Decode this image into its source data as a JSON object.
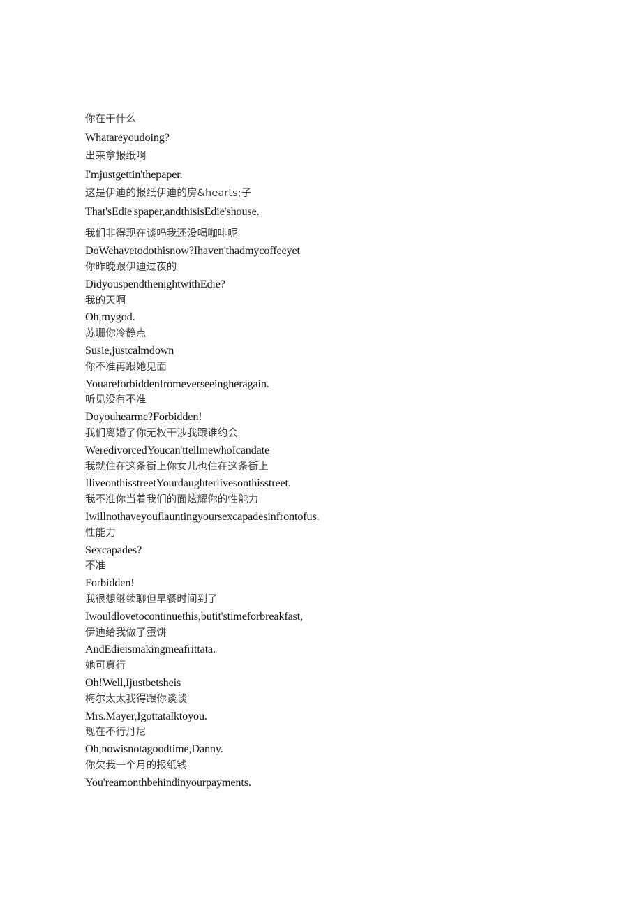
{
  "document": {
    "page_background": "#ffffff",
    "text_color_chinese": "#3d3d3d",
    "text_color_english": "#141414",
    "blocks": [
      {
        "id": "block-1",
        "lines": [
          {
            "lang": "zh",
            "text": "你在干什么"
          },
          {
            "lang": "en",
            "text": "Whatareyoudoing?"
          },
          {
            "lang": "zh",
            "text": "出来拿报纸啊"
          },
          {
            "lang": "en",
            "text": "I'mjustgettin'thepaper."
          },
          {
            "lang": "zh",
            "text": "这是伊迪的报纸伊迪的房&hearts;子"
          },
          {
            "lang": "en",
            "text": "That'sEdie'spaper,andthisisEdie'shouse."
          }
        ]
      },
      {
        "id": "block-2",
        "lines": [
          {
            "lang": "zh",
            "text": "我们非得现在谈吗我还没喝咖啡呢"
          },
          {
            "lang": "en",
            "text": "DoWehavetodothisnow?Ihaven'thadmycoffeeyet"
          },
          {
            "lang": "zh",
            "text": "你昨晚跟伊迪过夜的"
          },
          {
            "lang": "en",
            "text": "DidyouspendthenightwithEdie?"
          },
          {
            "lang": "zh",
            "text": "我的天啊"
          },
          {
            "lang": "en",
            "text": "Oh,mygod."
          },
          {
            "lang": "zh",
            "text": "苏珊你冷静点"
          },
          {
            "lang": "en",
            "text": "Susie,justcalmdown"
          },
          {
            "lang": "zh",
            "text": "你不准再跟她见面"
          },
          {
            "lang": "en",
            "text": "Youareforbiddenfromeverseeingheragain."
          },
          {
            "lang": "zh",
            "text": "听见没有不准"
          },
          {
            "lang": "en",
            "text": "Doyouhearme?Forbidden!"
          },
          {
            "lang": "zh",
            "text": "我们离婚了你无权干涉我跟谁约会"
          },
          {
            "lang": "en",
            "text": "WeredivorcedYoucan'ttellmewhoIcandate"
          },
          {
            "lang": "zh",
            "text": "我就住在这条街上你女儿也住在这条街上"
          },
          {
            "lang": "en",
            "text": "IliveonthisstreetYourdaughterlivesonthisstreet."
          },
          {
            "lang": "zh",
            "text": "我不准你当着我们的面炫耀你的性能力"
          },
          {
            "lang": "en",
            "text": "Iwillnothaveyouflauntingyoursexcapadesinfrontofus."
          },
          {
            "lang": "zh",
            "text": "性能力"
          },
          {
            "lang": "en",
            "text": "Sexcapades?"
          },
          {
            "lang": "zh",
            "text": "不准"
          },
          {
            "lang": "en",
            "text": "Forbidden!"
          },
          {
            "lang": "zh",
            "text": "我很想继续聊但早餐时间到了"
          },
          {
            "lang": "en",
            "text": "Iwouldlovetocontinuethis,butit'stimeforbreakfast,"
          },
          {
            "lang": "zh",
            "text": "伊迪给我做了蛋饼"
          },
          {
            "lang": "en",
            "text": "AndEdieismakingmeafrittata."
          },
          {
            "lang": "zh",
            "text": "她可真行"
          },
          {
            "lang": "en",
            "text": "Oh!Well,Ijustbetsheis"
          },
          {
            "lang": "zh",
            "text": "梅尔太太我得跟你谈谈"
          },
          {
            "lang": "en",
            "text": "Mrs.Mayer,Igottatalktoyou."
          },
          {
            "lang": "zh",
            "text": "现在不行丹尼"
          },
          {
            "lang": "en",
            "text": "Oh,nowisnotagoodtime,Danny."
          },
          {
            "lang": "zh",
            "text": "你欠我一个月的报纸钱"
          },
          {
            "lang": "en",
            "text": "You'reamonthbehindinyourpayments."
          }
        ]
      }
    ]
  }
}
